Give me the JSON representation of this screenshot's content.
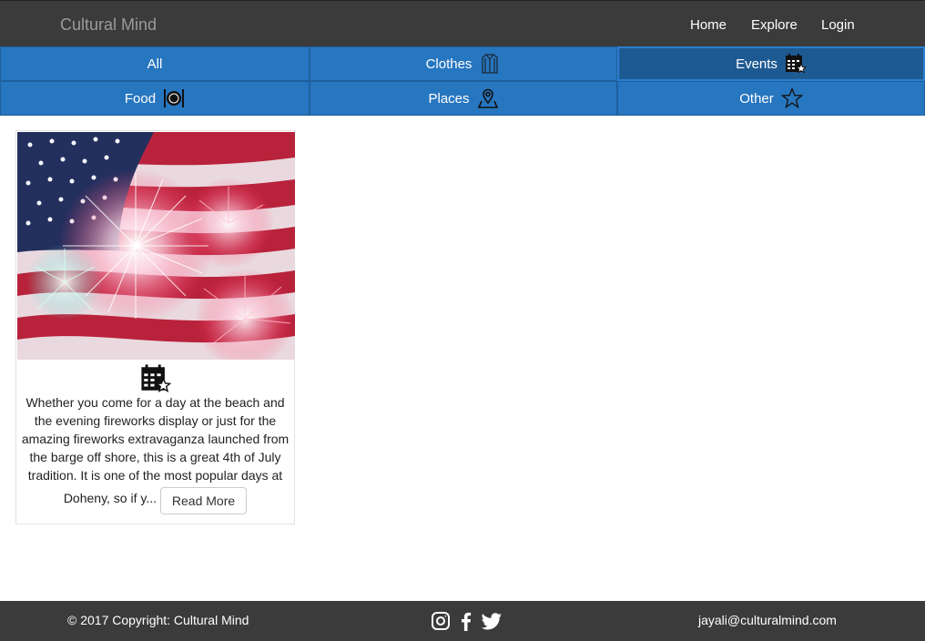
{
  "header": {
    "brand": "Cultural Mind",
    "nav": [
      {
        "label": "Home"
      },
      {
        "label": "Explore"
      },
      {
        "label": "Login"
      }
    ]
  },
  "categories": [
    {
      "label": "All",
      "icon": "",
      "active": false
    },
    {
      "label": "Clothes",
      "icon": "jacket-icon",
      "active": false
    },
    {
      "label": "Events",
      "icon": "calendar-star-icon",
      "active": true
    },
    {
      "label": "Food",
      "icon": "plate-cutlery-icon",
      "active": false
    },
    {
      "label": "Places",
      "icon": "map-pin-icon",
      "active": false
    },
    {
      "label": "Other",
      "icon": "star-icon",
      "active": false
    }
  ],
  "card": {
    "image_icon": "fireworks-flag-image",
    "category_icon": "calendar-star-icon",
    "description": "Whether you come for a day at the beach and the evening fireworks display or just for the amazing fireworks extravaganza launched from the barge off shore, this is a great 4th of July tradition. It is one of the most popular days at Doheny, so if y...",
    "button_label": "Read More"
  },
  "footer": {
    "copyright": "© 2017 Copyright: Cultural Mind",
    "email": "jayali@culturalmind.com",
    "social": [
      "instagram-icon",
      "facebook-icon",
      "twitter-icon"
    ]
  },
  "colors": {
    "topbar": "#3b3b3b",
    "category_bg": "#2776c0",
    "category_active": "#1e5a92"
  }
}
